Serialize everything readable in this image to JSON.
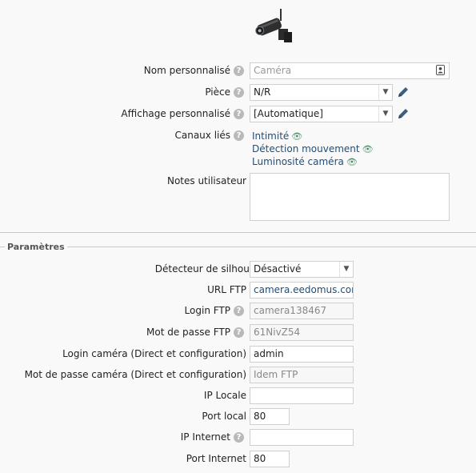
{
  "device": {
    "icon": "security-camera-icon",
    "fields": {
      "nom_personnalise": {
        "label": "Nom personnalisé",
        "placeholder": "Caméra"
      },
      "piece": {
        "label": "Pièce",
        "value": "N/R"
      },
      "affichage": {
        "label": "Affichage personnalisé",
        "value": "[Automatique]"
      },
      "canaux": {
        "label": "Canaux liés",
        "items": [
          "Intimité",
          "Détection mouvement",
          "Luminosité caméra"
        ]
      },
      "notes": {
        "label": "Notes utilisateur",
        "value": ""
      }
    }
  },
  "section": {
    "title": "Paramètres"
  },
  "params": {
    "detecteur": {
      "label": "Détecteur de silhouette",
      "value": "Désactivé"
    },
    "url_ftp": {
      "label": "URL FTP",
      "value": "camera.eedomus.com"
    },
    "login_ftp": {
      "label": "Login FTP",
      "value": "camera138467"
    },
    "mdp_ftp": {
      "label": "Mot de passe FTP",
      "value": "61NivZ54"
    },
    "login_cam": {
      "label": "Login caméra (Direct et configuration)",
      "value": "admin"
    },
    "mdp_cam": {
      "label": "Mot de passe caméra (Direct et configuration)",
      "placeholder": "Idem FTP"
    },
    "ip_locale": {
      "label": "IP Locale",
      "value": ""
    },
    "port_local": {
      "label": "Port local",
      "value": "80"
    },
    "ip_internet": {
      "label": "IP Internet",
      "value": ""
    },
    "port_internet": {
      "label": "Port Internet",
      "value": "80"
    }
  },
  "colors": {
    "link": "#1f4e79",
    "help": "#b9b9b9",
    "eye": "#4f8f6a",
    "pencil": "#3f5f7f"
  }
}
